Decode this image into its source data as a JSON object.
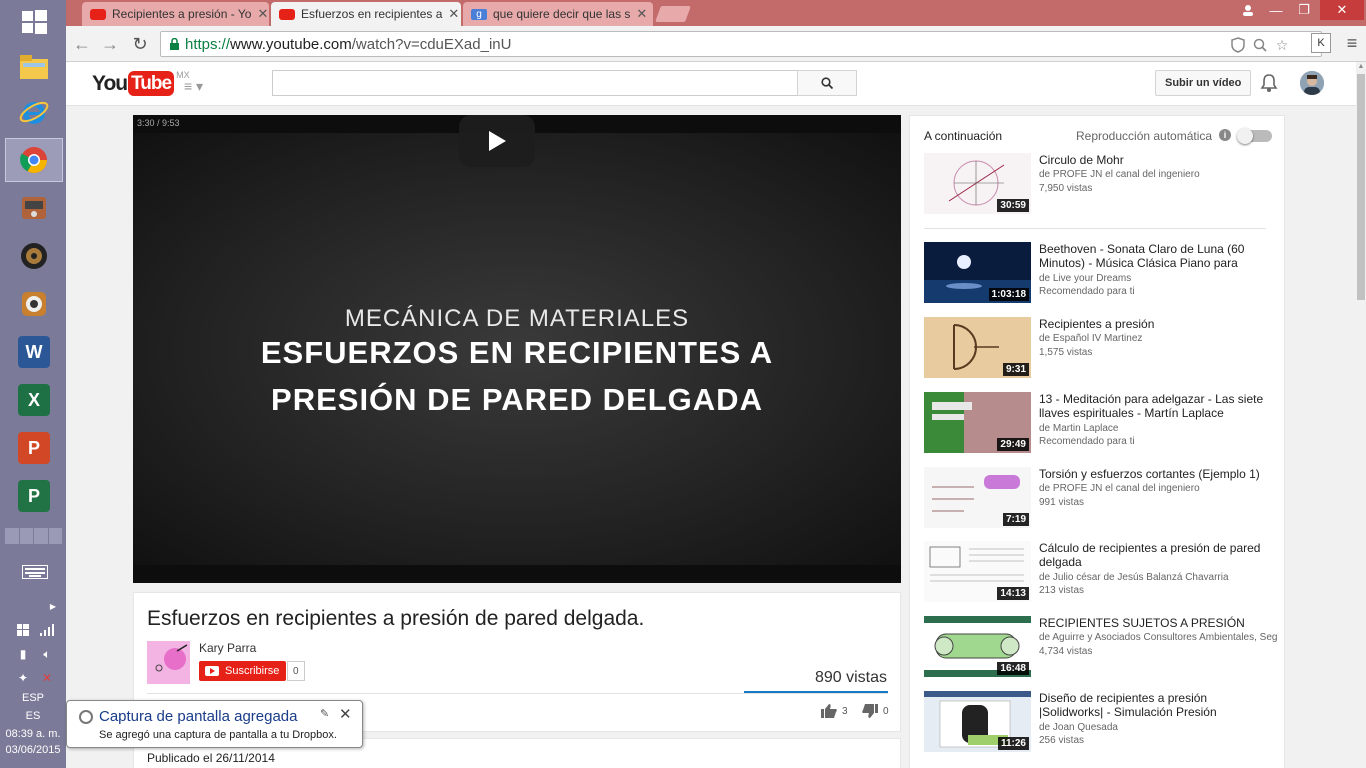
{
  "browser": {
    "tabs": [
      {
        "label": "Recipientes a presión - Yo",
        "icon": "youtube-icon"
      },
      {
        "label": "Esfuerzos en recipientes a",
        "icon": "youtube-icon"
      },
      {
        "label": "que quiere decir que las s",
        "icon": "google-icon"
      }
    ],
    "url_scheme": "https://",
    "url_host": "www.youtube.com",
    "url_path": "/watch?v=cduEXad_inU",
    "extension_label": "K"
  },
  "youtube": {
    "logo_you": "You",
    "logo_tube": "Tube",
    "region": "MX",
    "upload_label": "Subir un vídeo"
  },
  "video": {
    "overlay_time": "3:30 / 9:53",
    "subtitle": "MECÁNICA DE MATERIALES",
    "title_line1": "ESFUERZOS EN RECIPIENTES A",
    "title_line2": "PRESIÓN DE PARED DELGADA",
    "title": "Esfuerzos en recipientes a presión de pared delgada.",
    "channel": "Kary Parra",
    "subscribe_label": "Suscribirse",
    "subscriber_count": "0",
    "views": "890 vistas",
    "likes": "3",
    "dislikes": "0",
    "published": "Publicado el 26/11/2014"
  },
  "sidebar": {
    "next_label": "A continuación",
    "autoplay_label": "Reproducción automática",
    "items": [
      {
        "title": "Circulo de Mohr",
        "channel": "de PROFE JN el canal del ingeniero",
        "meta": "7,950 vistas",
        "duration": "30:59"
      },
      {
        "title": "Beethoven - Sonata Claro de Luna (60 Minutos) - Música Clásica Piano para",
        "channel": "de Live your Dreams",
        "meta": "Recomendado para ti",
        "duration": "1:03:18"
      },
      {
        "title": "Recipientes a presión",
        "channel": "de Español IV Martinez",
        "meta": "1,575 vistas",
        "duration": "9:31"
      },
      {
        "title": "13 - Meditación para adelgazar - Las siete llaves espirituales - Martín Laplace",
        "channel": "de Martin Laplace",
        "meta": "Recomendado para ti",
        "duration": "29:49"
      },
      {
        "title": "Torsión y esfuerzos cortantes (Ejemplo 1)",
        "channel": "de PROFE JN el canal del ingeniero",
        "meta": "991 vistas",
        "duration": "7:19"
      },
      {
        "title": "Cálculo de recipientes a presión de pared delgada",
        "channel": "de Julio césar de Jesús Balanzá Chavarria",
        "meta": "213 vistas",
        "duration": "14:13"
      },
      {
        "title": "RECIPIENTES SUJETOS A PRESIÓN",
        "channel": "de Aguirre y Asociados Consultores Ambientales, Seg",
        "meta": "4,734 vistas",
        "duration": "16:48"
      },
      {
        "title": "Diseño de recipientes a presión |Solidworks| - Simulación Presión",
        "channel": "de Joan Quesada",
        "meta": "256 vistas",
        "duration": "11:26"
      }
    ]
  },
  "taskbar": {
    "lang1": "ESP",
    "lang2": "ES",
    "time": "08:39 a. m.",
    "date": "03/06/2015"
  },
  "notification": {
    "title": "Captura de pantalla agregada",
    "body": "Se agregó una captura de pantalla a tu Dropbox."
  },
  "colors": {
    "youtube_red": "#e62117",
    "chrome_frame": "#c36a6a",
    "taskbar": "#7b7a98",
    "link_blue": "#167ac6"
  }
}
